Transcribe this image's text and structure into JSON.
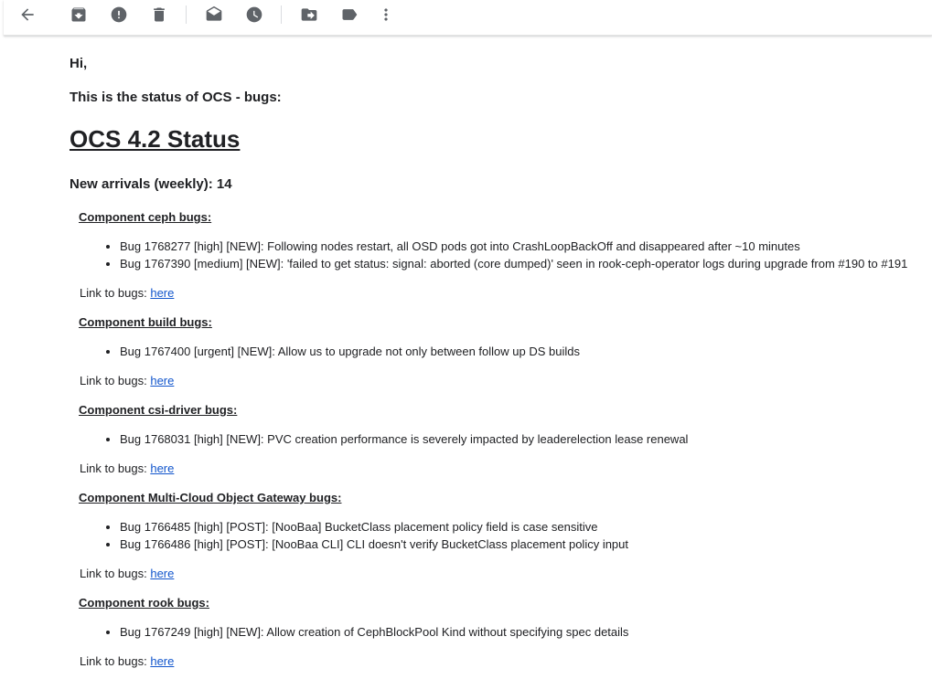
{
  "toolbar": {
    "buttons": [
      {
        "name": "back",
        "icon": "arrow-back-icon"
      },
      {
        "name": "archive",
        "icon": "archive-icon"
      },
      {
        "name": "report-spam",
        "icon": "report-spam-icon"
      },
      {
        "name": "delete",
        "icon": "delete-icon"
      },
      {
        "name": "mark-unread",
        "icon": "mark-unread-icon"
      },
      {
        "name": "snooze",
        "icon": "snooze-icon"
      },
      {
        "name": "move-to",
        "icon": "move-to-icon"
      },
      {
        "name": "labels",
        "icon": "label-icon"
      },
      {
        "name": "more",
        "icon": "more-vert-icon"
      }
    ],
    "icon_color": "#5f6368"
  },
  "email": {
    "greeting": "Hi,",
    "intro": "This is the status of OCS - bugs:",
    "title": "OCS 4.2 Status",
    "new_arrivals": "New arrivals (weekly): 14",
    "link_prefix": "Link to bugs:",
    "link_text": "here",
    "link_color": "#1155cc",
    "components": [
      {
        "title": "Component ceph bugs:",
        "bugs": [
          "Bug 1768277 [high] [NEW]: Following nodes restart, all OSD pods got into CrashLoopBackOff and disappeared after ~10 minutes",
          "Bug 1767390 [medium] [NEW]: 'failed to get status: signal: aborted (core dumped)' seen in rook-ceph-operator logs during upgrade from #190 to #191"
        ]
      },
      {
        "title": "Component build bugs:",
        "bugs": [
          "Bug 1767400 [urgent] [NEW]: Allow us to upgrade not only between follow up DS builds"
        ]
      },
      {
        "title": "Component csi-driver bugs:",
        "bugs": [
          "Bug 1768031 [high] [NEW]: PVC creation performance is severely impacted by leaderelection lease renewal"
        ]
      },
      {
        "title": "Component Multi-Cloud Object Gateway bugs:",
        "bugs": [
          "Bug 1766485 [high] [POST]: [NooBaa] BucketClass placement policy field is case sensitive",
          "Bug 1766486 [high] [POST]: [NooBaa CLI] CLI doesn't verify BucketClass placement policy input"
        ]
      },
      {
        "title": "Component rook bugs:",
        "bugs": [
          "Bug 1767249 [high] [NEW]: Allow creation of CephBlockPool Kind without specifying spec details"
        ]
      }
    ]
  }
}
